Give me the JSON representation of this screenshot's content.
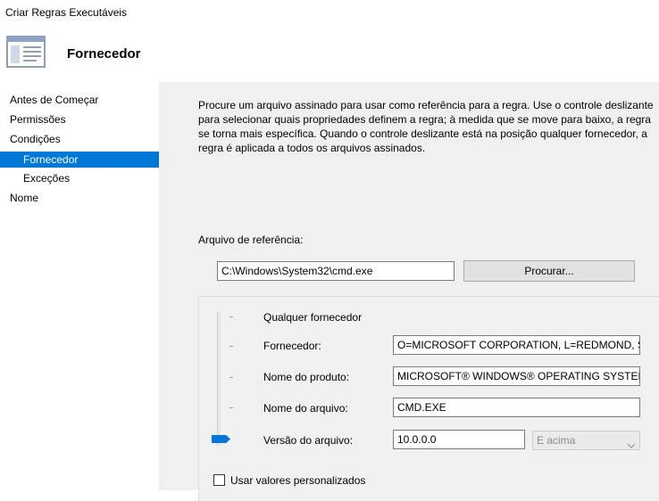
{
  "window": {
    "title": "Criar Regras Executáveis"
  },
  "header": {
    "title": "Fornecedor"
  },
  "nav": {
    "items": [
      {
        "label": "Antes de Começar"
      },
      {
        "label": "Permissões"
      },
      {
        "label": "Condições"
      },
      {
        "label": "Fornecedor"
      },
      {
        "label": "Exceções"
      },
      {
        "label": "Nome"
      }
    ]
  },
  "main": {
    "description": "Procure um arquivo assinado para usar como referência para a regra. Use o controle deslizante para selecionar quais propriedades definem a regra; à medida que se move para baixo, a regra se torna mais específica. Quando o controle deslizante está na posição qualquer fornecedor, a regra é aplicada a todos os arquivos assinados.",
    "reference_label": "Arquivo de referência:",
    "reference_value": "C:\\Windows\\System32\\cmd.exe",
    "browse_label": "Procurar...",
    "any_publisher_label": "Qualquer fornecedor",
    "fields": {
      "publisher": {
        "label": "Fornecedor:",
        "value": "O=MICROSOFT CORPORATION, L=REDMOND, S=WASHINGTON, C=US"
      },
      "product": {
        "label": "Nome do produto:",
        "value": "MICROSOFT® WINDOWS® OPERATING SYSTEM"
      },
      "filename": {
        "label": "Nome do arquivo:",
        "value": "CMD.EXE"
      },
      "version": {
        "label": "Versão do arquivo:",
        "value": "10.0.0.0",
        "option": "E acima"
      }
    },
    "custom_values_label": "Usar valores personalizados"
  },
  "slider": {
    "level": 4,
    "max": 4
  },
  "colors": {
    "accent": "#0078d7",
    "panel": "#f0f0f0"
  }
}
